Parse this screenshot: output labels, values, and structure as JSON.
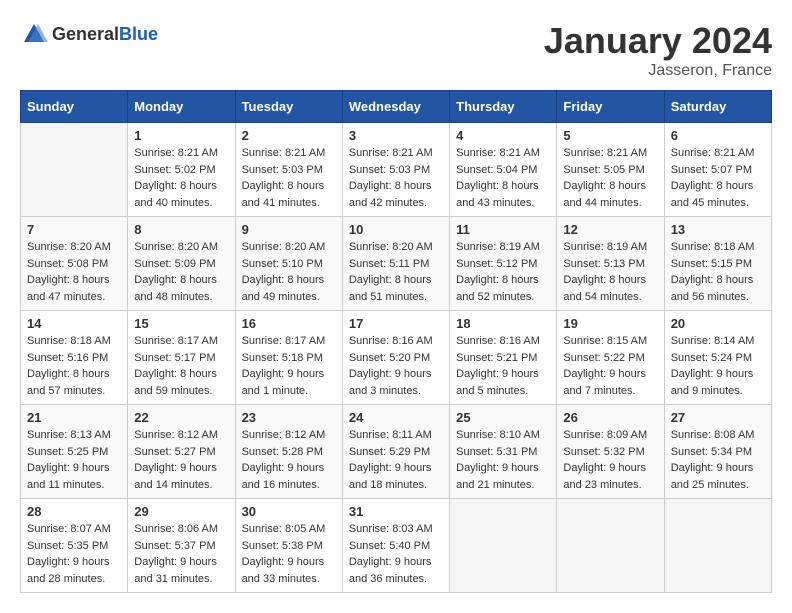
{
  "header": {
    "logo_general": "General",
    "logo_blue": "Blue",
    "month_title": "January 2024",
    "location": "Jasseron, France"
  },
  "weekdays": [
    "Sunday",
    "Monday",
    "Tuesday",
    "Wednesday",
    "Thursday",
    "Friday",
    "Saturday"
  ],
  "weeks": [
    [
      {
        "day": "",
        "info": ""
      },
      {
        "day": "1",
        "info": "Sunrise: 8:21 AM\nSunset: 5:02 PM\nDaylight: 8 hours\nand 40 minutes."
      },
      {
        "day": "2",
        "info": "Sunrise: 8:21 AM\nSunset: 5:03 PM\nDaylight: 8 hours\nand 41 minutes."
      },
      {
        "day": "3",
        "info": "Sunrise: 8:21 AM\nSunset: 5:03 PM\nDaylight: 8 hours\nand 42 minutes."
      },
      {
        "day": "4",
        "info": "Sunrise: 8:21 AM\nSunset: 5:04 PM\nDaylight: 8 hours\nand 43 minutes."
      },
      {
        "day": "5",
        "info": "Sunrise: 8:21 AM\nSunset: 5:05 PM\nDaylight: 8 hours\nand 44 minutes."
      },
      {
        "day": "6",
        "info": "Sunrise: 8:21 AM\nSunset: 5:07 PM\nDaylight: 8 hours\nand 45 minutes."
      }
    ],
    [
      {
        "day": "7",
        "info": "Sunrise: 8:20 AM\nSunset: 5:08 PM\nDaylight: 8 hours\nand 47 minutes."
      },
      {
        "day": "8",
        "info": "Sunrise: 8:20 AM\nSunset: 5:09 PM\nDaylight: 8 hours\nand 48 minutes."
      },
      {
        "day": "9",
        "info": "Sunrise: 8:20 AM\nSunset: 5:10 PM\nDaylight: 8 hours\nand 49 minutes."
      },
      {
        "day": "10",
        "info": "Sunrise: 8:20 AM\nSunset: 5:11 PM\nDaylight: 8 hours\nand 51 minutes."
      },
      {
        "day": "11",
        "info": "Sunrise: 8:19 AM\nSunset: 5:12 PM\nDaylight: 8 hours\nand 52 minutes."
      },
      {
        "day": "12",
        "info": "Sunrise: 8:19 AM\nSunset: 5:13 PM\nDaylight: 8 hours\nand 54 minutes."
      },
      {
        "day": "13",
        "info": "Sunrise: 8:18 AM\nSunset: 5:15 PM\nDaylight: 8 hours\nand 56 minutes."
      }
    ],
    [
      {
        "day": "14",
        "info": "Sunrise: 8:18 AM\nSunset: 5:16 PM\nDaylight: 8 hours\nand 57 minutes."
      },
      {
        "day": "15",
        "info": "Sunrise: 8:17 AM\nSunset: 5:17 PM\nDaylight: 8 hours\nand 59 minutes."
      },
      {
        "day": "16",
        "info": "Sunrise: 8:17 AM\nSunset: 5:18 PM\nDaylight: 9 hours\nand 1 minute."
      },
      {
        "day": "17",
        "info": "Sunrise: 8:16 AM\nSunset: 5:20 PM\nDaylight: 9 hours\nand 3 minutes."
      },
      {
        "day": "18",
        "info": "Sunrise: 8:16 AM\nSunset: 5:21 PM\nDaylight: 9 hours\nand 5 minutes."
      },
      {
        "day": "19",
        "info": "Sunrise: 8:15 AM\nSunset: 5:22 PM\nDaylight: 9 hours\nand 7 minutes."
      },
      {
        "day": "20",
        "info": "Sunrise: 8:14 AM\nSunset: 5:24 PM\nDaylight: 9 hours\nand 9 minutes."
      }
    ],
    [
      {
        "day": "21",
        "info": "Sunrise: 8:13 AM\nSunset: 5:25 PM\nDaylight: 9 hours\nand 11 minutes."
      },
      {
        "day": "22",
        "info": "Sunrise: 8:12 AM\nSunset: 5:27 PM\nDaylight: 9 hours\nand 14 minutes."
      },
      {
        "day": "23",
        "info": "Sunrise: 8:12 AM\nSunset: 5:28 PM\nDaylight: 9 hours\nand 16 minutes."
      },
      {
        "day": "24",
        "info": "Sunrise: 8:11 AM\nSunset: 5:29 PM\nDaylight: 9 hours\nand 18 minutes."
      },
      {
        "day": "25",
        "info": "Sunrise: 8:10 AM\nSunset: 5:31 PM\nDaylight: 9 hours\nand 21 minutes."
      },
      {
        "day": "26",
        "info": "Sunrise: 8:09 AM\nSunset: 5:32 PM\nDaylight: 9 hours\nand 23 minutes."
      },
      {
        "day": "27",
        "info": "Sunrise: 8:08 AM\nSunset: 5:34 PM\nDaylight: 9 hours\nand 25 minutes."
      }
    ],
    [
      {
        "day": "28",
        "info": "Sunrise: 8:07 AM\nSunset: 5:35 PM\nDaylight: 9 hours\nand 28 minutes."
      },
      {
        "day": "29",
        "info": "Sunrise: 8:06 AM\nSunset: 5:37 PM\nDaylight: 9 hours\nand 31 minutes."
      },
      {
        "day": "30",
        "info": "Sunrise: 8:05 AM\nSunset: 5:38 PM\nDaylight: 9 hours\nand 33 minutes."
      },
      {
        "day": "31",
        "info": "Sunrise: 8:03 AM\nSunset: 5:40 PM\nDaylight: 9 hours\nand 36 minutes."
      },
      {
        "day": "",
        "info": ""
      },
      {
        "day": "",
        "info": ""
      },
      {
        "day": "",
        "info": ""
      }
    ]
  ]
}
